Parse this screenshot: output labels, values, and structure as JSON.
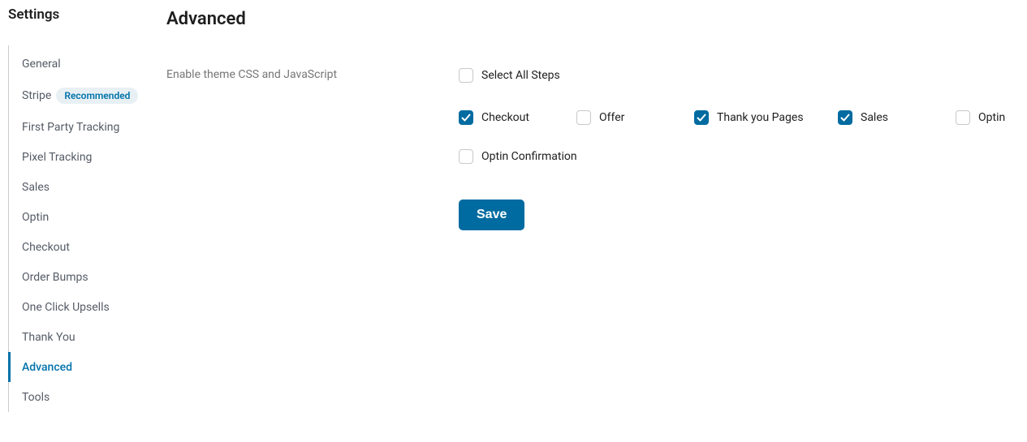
{
  "sidebar": {
    "title": "Settings",
    "items": [
      {
        "label": "General",
        "active": false,
        "badge": null
      },
      {
        "label": "Stripe",
        "active": false,
        "badge": "Recommended"
      },
      {
        "label": "First Party Tracking",
        "active": false,
        "badge": null
      },
      {
        "label": "Pixel Tracking",
        "active": false,
        "badge": null
      },
      {
        "label": "Sales",
        "active": false,
        "badge": null
      },
      {
        "label": "Optin",
        "active": false,
        "badge": null
      },
      {
        "label": "Checkout",
        "active": false,
        "badge": null
      },
      {
        "label": "Order Bumps",
        "active": false,
        "badge": null
      },
      {
        "label": "One Click Upsells",
        "active": false,
        "badge": null
      },
      {
        "label": "Thank You",
        "active": false,
        "badge": null
      },
      {
        "label": "Advanced",
        "active": true,
        "badge": null
      },
      {
        "label": "Tools",
        "active": false,
        "badge": null
      }
    ]
  },
  "main": {
    "title": "Advanced",
    "setting": {
      "label": "Enable theme CSS and JavaScript",
      "options": {
        "select_all": {
          "label": "Select All Steps",
          "checked": false
        },
        "row": [
          {
            "label": "Checkout",
            "checked": true
          },
          {
            "label": "Offer",
            "checked": false
          },
          {
            "label": "Thank you Pages",
            "checked": true
          },
          {
            "label": "Sales",
            "checked": true
          },
          {
            "label": "Optin",
            "checked": false
          }
        ],
        "optin_confirmation": {
          "label": "Optin Confirmation",
          "checked": false
        }
      }
    },
    "save_label": "Save"
  }
}
